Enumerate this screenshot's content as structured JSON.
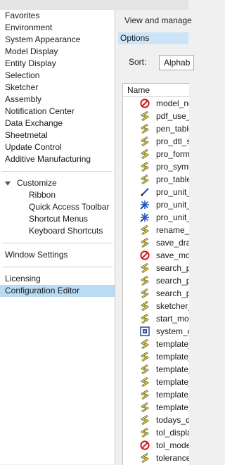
{
  "sidebar": {
    "items": [
      "Favorites",
      "Environment",
      "System Appearance",
      "Model Display",
      "Entity Display",
      "Selection",
      "Sketcher",
      "Assembly",
      "Notification Center",
      "Data Exchange",
      "Sheetmetal",
      "Update Control",
      "Additive Manufacturing"
    ],
    "customize": {
      "label": "Customize",
      "children": [
        "Ribbon",
        "Quick Access Toolbar",
        "Shortcut Menus",
        "Keyboard Shortcuts"
      ]
    },
    "window_settings": "Window Settings",
    "licensing": "Licensing",
    "configuration_editor": "Configuration Editor"
  },
  "main": {
    "description": "View and manage",
    "options_label": "Options",
    "sort_label": "Sort:",
    "sort_value": "Alphab",
    "table": {
      "column_header": "Name",
      "rows": [
        {
          "name": "model_no",
          "icon": "no-entry-icon"
        },
        {
          "name": "pdf_use_p",
          "icon": "lightning-icon"
        },
        {
          "name": "pen_table",
          "icon": "lightning-icon"
        },
        {
          "name": "pro_dtl_se",
          "icon": "lightning-icon"
        },
        {
          "name": "pro_form",
          "icon": "lightning-icon"
        },
        {
          "name": "pro_symb",
          "icon": "lightning-icon"
        },
        {
          "name": "pro_table",
          "icon": "lightning-icon"
        },
        {
          "name": "pro_unit_",
          "icon": "pen-icon"
        },
        {
          "name": "pro_unit_",
          "icon": "star-icon"
        },
        {
          "name": "pro_unit_",
          "icon": "star-icon"
        },
        {
          "name": "rename_d",
          "icon": "lightning-icon"
        },
        {
          "name": "save_draw",
          "icon": "lightning-icon"
        },
        {
          "name": "save_moc",
          "icon": "no-entry-icon"
        },
        {
          "name": "search_pa",
          "icon": "lightning-icon"
        },
        {
          "name": "search_pa",
          "icon": "lightning-icon"
        },
        {
          "name": "search_pa",
          "icon": "lightning-icon"
        },
        {
          "name": "sketcher_",
          "icon": "lightning-icon"
        },
        {
          "name": "start_moc",
          "icon": "lightning-icon"
        },
        {
          "name": "system_c",
          "icon": "system-icon"
        },
        {
          "name": "template_",
          "icon": "lightning-icon"
        },
        {
          "name": "template_",
          "icon": "lightning-icon"
        },
        {
          "name": "template_",
          "icon": "lightning-icon"
        },
        {
          "name": "template_",
          "icon": "lightning-icon"
        },
        {
          "name": "template_",
          "icon": "lightning-icon"
        },
        {
          "name": "template_",
          "icon": "lightning-icon"
        },
        {
          "name": "todays_da",
          "icon": "lightning-icon"
        },
        {
          "name": "tol_displa",
          "icon": "lightning-icon"
        },
        {
          "name": "tol_mode",
          "icon": "no-entry-icon"
        },
        {
          "name": "tolerance",
          "icon": "lightning-icon"
        }
      ]
    }
  },
  "colors": {
    "selection": "#b9dcf4",
    "options_bar": "#cce4f7",
    "lightning": "#e8d23a",
    "no_entry": "#d0161c",
    "pen": "#1f47a6",
    "star": "#2458c8"
  }
}
